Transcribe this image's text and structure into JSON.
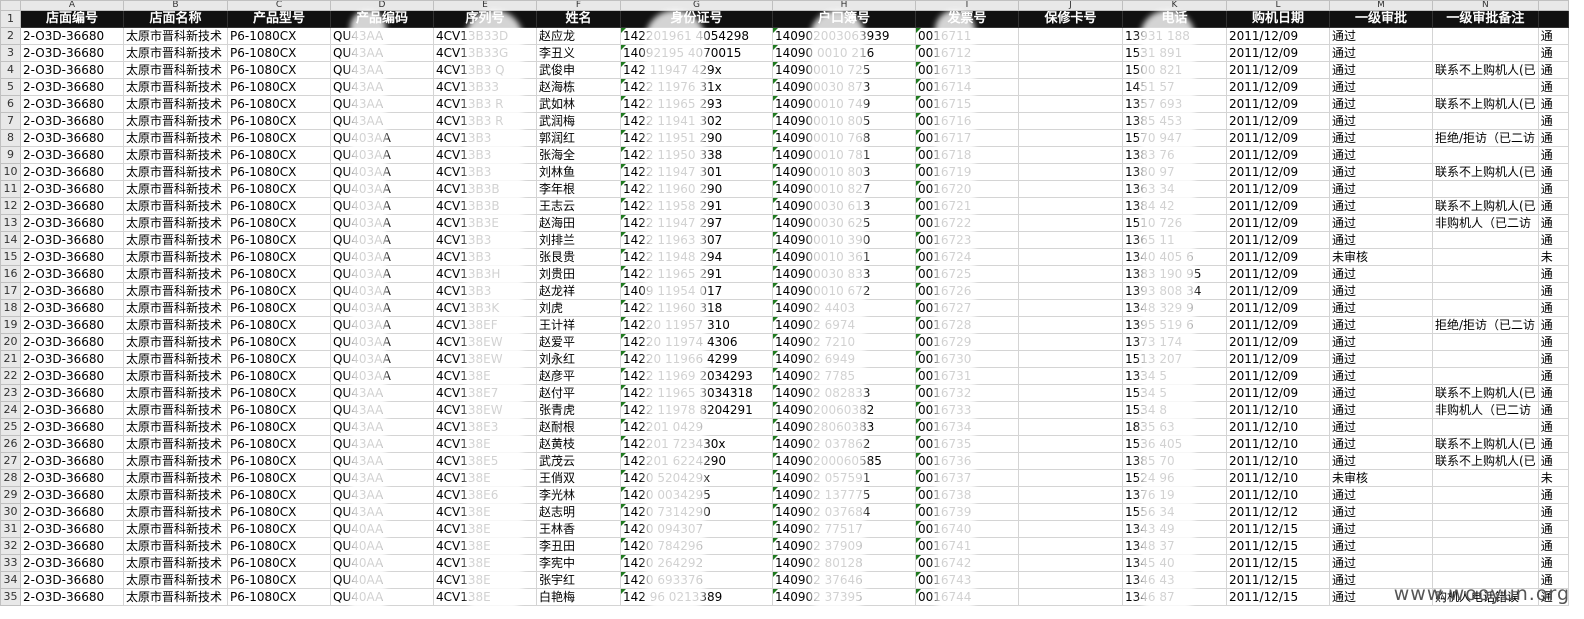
{
  "columns": [
    "A",
    "B",
    "C",
    "D",
    "E",
    "F",
    "G",
    "H",
    "I",
    "J",
    "K",
    "L",
    "M",
    "N"
  ],
  "headers": [
    "店面编号",
    "店面名称",
    "产品型号",
    "产品编码",
    "序列号",
    "姓名",
    "身份证号",
    "户口簿号",
    "发票号",
    "保修卡号",
    "电话",
    "购机日期",
    "一级审批",
    "一级审批备注"
  ],
  "rows": [
    {
      "n": "2",
      "a": "2-O3D-36680",
      "b": "太原市晋科新技术",
      "c": "P6-1080CX",
      "d": "QU43AA",
      "e": "4CV13B33D",
      "f": "赵应龙",
      "g": "142201961 4054298",
      "h": "140902003063939",
      "i": "0016711",
      "j": "",
      "k": "13931 188",
      "l": "2011/12/09",
      "m": "通过",
      "n2": "",
      "o": "通"
    },
    {
      "n": "3",
      "a": "2-O3D-36680",
      "b": "太原市晋科新技术",
      "c": "P6-1080CX",
      "d": "QU43AA",
      "e": "4CV13B33G",
      "f": "李丑义",
      "g": "14092195 4070015",
      "h": "14090 0010 216",
      "i": "0016712",
      "j": "",
      "k": "1531 891",
      "l": "2011/12/09",
      "m": "通过",
      "n2": "",
      "o": "通"
    },
    {
      "n": "4",
      "a": "2-O3D-36680",
      "b": "太原市晋科新技术",
      "c": "P6-1080CX",
      "d": "QU43AA",
      "e": "4CV13B3 Q",
      "f": "武俊申",
      "g": "142 11947 429x",
      "h": "140900010 725",
      "i": "0016713",
      "j": "",
      "k": "1500 821",
      "l": "2011/12/09",
      "m": "通过",
      "n2": "联系不上购机人(已",
      "o": "通"
    },
    {
      "n": "5",
      "a": "2-O3D-36680",
      "b": "太原市晋科新技术",
      "c": "P6-1080CX",
      "d": "QU43AA",
      "e": "4CV13B33",
      "f": "赵海栋",
      "g": "1422 11976 31x",
      "h": "140900030 873",
      "i": "0016714",
      "j": "",
      "k": "1451 57",
      "l": "2011/12/09",
      "m": "通过",
      "n2": "",
      "o": "通"
    },
    {
      "n": "6",
      "a": "2-O3D-36680",
      "b": "太原市晋科新技术",
      "c": "P6-1080CX",
      "d": "QU43AA",
      "e": "4CV13B3 R",
      "f": "武如林",
      "g": "1422 11965 293",
      "h": "140900010 749",
      "i": "0016715",
      "j": "",
      "k": "1357 693",
      "l": "2011/12/09",
      "m": "通过",
      "n2": "联系不上购机人(已",
      "o": "通"
    },
    {
      "n": "7",
      "a": "2-O3D-36680",
      "b": "太原市晋科新技术",
      "c": "P6-1080CX",
      "d": "QU43AA",
      "e": "4CV13B3 R",
      "f": "武润梅",
      "g": "1422 11941 302",
      "h": "140900010 805",
      "i": "0016716",
      "j": "",
      "k": "1385 453",
      "l": "2011/12/09",
      "m": "通过",
      "n2": "",
      "o": "通"
    },
    {
      "n": "8",
      "a": "2-O3D-36680",
      "b": "太原市晋科新技术",
      "c": "P6-1080CX",
      "d": "QU403AA",
      "e": "4CV13B3",
      "f": "郭润红",
      "g": "1422 11951 290",
      "h": "140900010 768",
      "i": "0016717",
      "j": "",
      "k": "1570 947",
      "l": "2011/12/09",
      "m": "通过",
      "n2": "拒绝/拒访（已二访",
      "o": "通"
    },
    {
      "n": "9",
      "a": "2-O3D-36680",
      "b": "太原市晋科新技术",
      "c": "P6-1080CX",
      "d": "QU403AA",
      "e": "4CV13B3",
      "f": "张海全",
      "g": "1422 11950 338",
      "h": "140900010 781",
      "i": "0016718",
      "j": "",
      "k": "1383 76",
      "l": "2011/12/09",
      "m": "通过",
      "n2": "",
      "o": "通"
    },
    {
      "n": "10",
      "a": "2-O3D-36680",
      "b": "太原市晋科新技术",
      "c": "P6-1080CX",
      "d": "QU403AA",
      "e": "4CV13B3",
      "f": "刘林鱼",
      "g": "1422 11947 301",
      "h": "140900010 803",
      "i": "0016719",
      "j": "",
      "k": "1380 97",
      "l": "2011/12/09",
      "m": "通过",
      "n2": "联系不上购机人(已",
      "o": "通"
    },
    {
      "n": "11",
      "a": "2-O3D-36680",
      "b": "太原市晋科新技术",
      "c": "P6-1080CX",
      "d": "QU403AA",
      "e": "4CV13B3B",
      "f": "李年根",
      "g": "1422 11960 290",
      "h": "140900010 827",
      "i": "0016720",
      "j": "",
      "k": "1363 34",
      "l": "2011/12/09",
      "m": "通过",
      "n2": "",
      "o": "通"
    },
    {
      "n": "12",
      "a": "2-O3D-36680",
      "b": "太原市晋科新技术",
      "c": "P6-1080CX",
      "d": "QU403AA",
      "e": "4CV13B3B",
      "f": "王志云",
      "g": "1422 11958 291",
      "h": "140900030 613",
      "i": "0016721",
      "j": "",
      "k": "1384 42",
      "l": "2011/12/09",
      "m": "通过",
      "n2": "联系不上购机人(已",
      "o": "通"
    },
    {
      "n": "13",
      "a": "2-O3D-36680",
      "b": "太原市晋科新技术",
      "c": "P6-1080CX",
      "d": "QU403AA",
      "e": "4CV13B3E",
      "f": "赵海田",
      "g": "1422 11947 297",
      "h": "140900030 625",
      "i": "0016722",
      "j": "",
      "k": "1510 726",
      "l": "2011/12/09",
      "m": "通过",
      "n2": "非购机人（已二访",
      "o": "通"
    },
    {
      "n": "14",
      "a": "2-O3D-36680",
      "b": "太原市晋科新技术",
      "c": "P6-1080CX",
      "d": "QU403AA",
      "e": "4CV13B3",
      "f": "刘排兰",
      "g": "1422 11963 307",
      "h": "140900010 390",
      "i": "0016723",
      "j": "",
      "k": "1365 11",
      "l": "2011/12/09",
      "m": "通过",
      "n2": "",
      "o": "通"
    },
    {
      "n": "15",
      "a": "2-O3D-36680",
      "b": "太原市晋科新技术",
      "c": "P6-1080CX",
      "d": "QU403AA",
      "e": "4CV13B3",
      "f": "张艮贵",
      "g": "1422 11948 294",
      "h": "140900010 361",
      "i": "0016724",
      "j": "",
      "k": "1340 405 6",
      "l": "2011/12/09",
      "m": "未审核",
      "n2": "",
      "o": "未"
    },
    {
      "n": "16",
      "a": "2-O3D-36680",
      "b": "太原市晋科新技术",
      "c": "P6-1080CX",
      "d": "QU403AA",
      "e": "4CV13B3H",
      "f": "刘贵田",
      "g": "1422 11965 291",
      "h": "140900030 833",
      "i": "0016725",
      "j": "",
      "k": "1383 190 95",
      "l": "2011/12/09",
      "m": "通过",
      "n2": "",
      "o": "通"
    },
    {
      "n": "17",
      "a": "2-O3D-36680",
      "b": "太原市晋科新技术",
      "c": "P6-1080CX",
      "d": "QU403AA",
      "e": "4CV13B3",
      "f": "赵龙祥",
      "g": "1409 11954 017",
      "h": "140900010 672",
      "i": "0016726",
      "j": "",
      "k": "1393 808 34",
      "l": "2011/12/09",
      "m": "通过",
      "n2": "",
      "o": "通"
    },
    {
      "n": "18",
      "a": "2-O3D-36680",
      "b": "太原市晋科新技术",
      "c": "P6-1080CX",
      "d": "QU403AA",
      "e": "4CV13B3K",
      "f": "刘虎",
      "g": "1422 11960 318",
      "h": "140902 4403",
      "i": "0016727",
      "j": "",
      "k": "1348 329 9",
      "l": "2011/12/09",
      "m": "通过",
      "n2": "",
      "o": "通"
    },
    {
      "n": "19",
      "a": "2-O3D-36680",
      "b": "太原市晋科新技术",
      "c": "P6-1080CX",
      "d": "QU403AA",
      "e": "4CV138EF",
      "f": "王计祥",
      "g": "14220 11957 310",
      "h": "140902 6974",
      "i": "0016728",
      "j": "",
      "k": "1395 519 6",
      "l": "2011/12/09",
      "m": "通过",
      "n2": "拒绝/拒访（已二访",
      "o": "通"
    },
    {
      "n": "20",
      "a": "2-O3D-36680",
      "b": "太原市晋科新技术",
      "c": "P6-1080CX",
      "d": "QU403AA",
      "e": "4CV138EW",
      "f": "赵爱平",
      "g": "14220 11974 4306",
      "h": "140902 7210",
      "i": "0016729",
      "j": "",
      "k": "1373 174",
      "l": "2011/12/09",
      "m": "通过",
      "n2": "",
      "o": "通"
    },
    {
      "n": "21",
      "a": "2-O3D-36680",
      "b": "太原市晋科新技术",
      "c": "P6-1080CX",
      "d": "QU403AA",
      "e": "4CV138EW",
      "f": "刘永红",
      "g": "14220 11966 4299",
      "h": "140902 6949",
      "i": "0016730",
      "j": "",
      "k": "1513 207",
      "l": "2011/12/09",
      "m": "通过",
      "n2": "",
      "o": "通"
    },
    {
      "n": "22",
      "a": "2-O3D-36680",
      "b": "太原市晋科新技术",
      "c": "P6-1080CX",
      "d": "QU403AA",
      "e": "4CV138E",
      "f": "赵彦平",
      "g": "1422 11969 2034293",
      "h": "140902 7785",
      "i": "0016731",
      "j": "",
      "k": "1334 5",
      "l": "2011/12/09",
      "m": "通过",
      "n2": "",
      "o": "通"
    },
    {
      "n": "23",
      "a": "2-O3D-36680",
      "b": "太原市晋科新技术",
      "c": "P6-1080CX",
      "d": "QU43AA",
      "e": "4CV138E7",
      "f": "赵付平",
      "g": "1422 11965 3034318",
      "h": "140902 082833",
      "i": "0016732",
      "j": "",
      "k": "1534 5",
      "l": "2011/12/09",
      "m": "通过",
      "n2": "联系不上购机人(已",
      "o": "通"
    },
    {
      "n": "24",
      "a": "2-O3D-36680",
      "b": "太原市晋科新技术",
      "c": "P6-1080CX",
      "d": "QU43AA",
      "e": "4CV138EW",
      "f": "张青虎",
      "g": "1422 11978 8204291",
      "h": "1409020060382",
      "i": "0016733",
      "j": "",
      "k": "1534 8",
      "l": "2011/12/10",
      "m": "通过",
      "n2": "非购机人（已二访",
      "o": "通"
    },
    {
      "n": "25",
      "a": "2-O3D-36680",
      "b": "太原市晋科新技术",
      "c": "P6-1080CX",
      "d": "QU43AA",
      "e": "4CV138E3",
      "f": "赵耐根",
      "g": "142201 0429",
      "h": "1409028060383",
      "i": "0016734",
      "j": "",
      "k": "1835 63",
      "l": "2011/12/10",
      "m": "通过",
      "n2": "",
      "o": "通"
    },
    {
      "n": "26",
      "a": "2-O3D-36680",
      "b": "太原市晋科新技术",
      "c": "P6-1080CX",
      "d": "QU43AA",
      "e": "4CV138E",
      "f": "赵黄枝",
      "g": "142201 723430x",
      "h": "140902 037862",
      "i": "0016735",
      "j": "",
      "k": "1536 405",
      "l": "2011/12/10",
      "m": "通过",
      "n2": "联系不上购机人(已",
      "o": "通"
    },
    {
      "n": "27",
      "a": "2-O3D-36680",
      "b": "太原市晋科新技术",
      "c": "P6-1080CX",
      "d": "QU43AA",
      "e": "4CV138E5",
      "f": "武茂云",
      "g": "142201 6224290",
      "h": "14090200060585",
      "i": "0016736",
      "j": "",
      "k": "1385 70",
      "l": "2011/12/10",
      "m": "通过",
      "n2": "联系不上购机人(已",
      "o": "通"
    },
    {
      "n": "28",
      "a": "2-O3D-36680",
      "b": "太原市晋科新技术",
      "c": "P6-1080CX",
      "d": "QU43AA",
      "e": "4CV138E",
      "f": "王俏双",
      "g": "1420 520429x",
      "h": "140902 057591",
      "i": "0016737",
      "j": "",
      "k": "1524 96",
      "l": "2011/12/10",
      "m": "未审核",
      "n2": "",
      "o": "未"
    },
    {
      "n": "29",
      "a": "2-O3D-36680",
      "b": "太原市晋科新技术",
      "c": "P6-1080CX",
      "d": "QU43AA",
      "e": "4CV138E6",
      "f": "李光林",
      "g": "1420 0034295",
      "h": "140902 137775",
      "i": "0016738",
      "j": "",
      "k": "1376 19",
      "l": "2011/12/10",
      "m": "通过",
      "n2": "",
      "o": "通"
    },
    {
      "n": "30",
      "a": "2-O3D-36680",
      "b": "太原市晋科新技术",
      "c": "P6-1080CX",
      "d": "QU43AA",
      "e": "4CV138E",
      "f": "赵志明",
      "g": "1420 7314290",
      "h": "140902 037684",
      "i": "0016739",
      "j": "",
      "k": "1556 34",
      "l": "2011/12/12",
      "m": "通过",
      "n2": "",
      "o": "通"
    },
    {
      "n": "31",
      "a": "2-O3D-36680",
      "b": "太原市晋科新技术",
      "c": "P6-1080CX",
      "d": "QU40AA",
      "e": "4CV138E",
      "f": "王林香",
      "g": "1420 094307",
      "h": "140902 77517",
      "i": "0016740",
      "j": "",
      "k": "1343 49",
      "l": "2011/12/15",
      "m": "通过",
      "n2": "",
      "o": "通"
    },
    {
      "n": "32",
      "a": "2-O3D-36680",
      "b": "太原市晋科新技术",
      "c": "P6-1080CX",
      "d": "QU40AA",
      "e": "4CV138E",
      "f": "李丑田",
      "g": "1420 784296",
      "h": "140902 37909",
      "i": "0016741",
      "j": "",
      "k": "1348 37",
      "l": "2011/12/15",
      "m": "通过",
      "n2": "",
      "o": "通"
    },
    {
      "n": "33",
      "a": "2-O3D-36680",
      "b": "太原市晋科新技术",
      "c": "P6-1080CX",
      "d": "QU40AA",
      "e": "4CV138E",
      "f": "李宪中",
      "g": "1420 264292",
      "h": "140902 80128",
      "i": "0016742",
      "j": "",
      "k": "1345 40",
      "l": "2011/12/15",
      "m": "通过",
      "n2": "",
      "o": "通"
    },
    {
      "n": "34",
      "a": "2-O3D-36680",
      "b": "太原市晋科新技术",
      "c": "P6-1080CX",
      "d": "QU40AA",
      "e": "4CV138E",
      "f": "张宇红",
      "g": "1420 693376",
      "h": "140902 37646",
      "i": "0016743",
      "j": "",
      "k": "1346 43",
      "l": "2011/12/15",
      "m": "通过",
      "n2": "",
      "o": "通"
    },
    {
      "n": "35",
      "a": "2-O3D-36680",
      "b": "太原市晋科新技术",
      "c": "P6-1080CX",
      "d": "QU40AA",
      "e": "4CV138E",
      "f": "白艳梅",
      "g": "142 96 0213389",
      "h": "140902 37395",
      "i": "0016744",
      "j": "",
      "k": "1346 87",
      "l": "2011/12/15",
      "m": "通过",
      "n2": "购机人电话错误",
      "o": "通"
    }
  ],
  "watermark": "www.wooyun.org"
}
